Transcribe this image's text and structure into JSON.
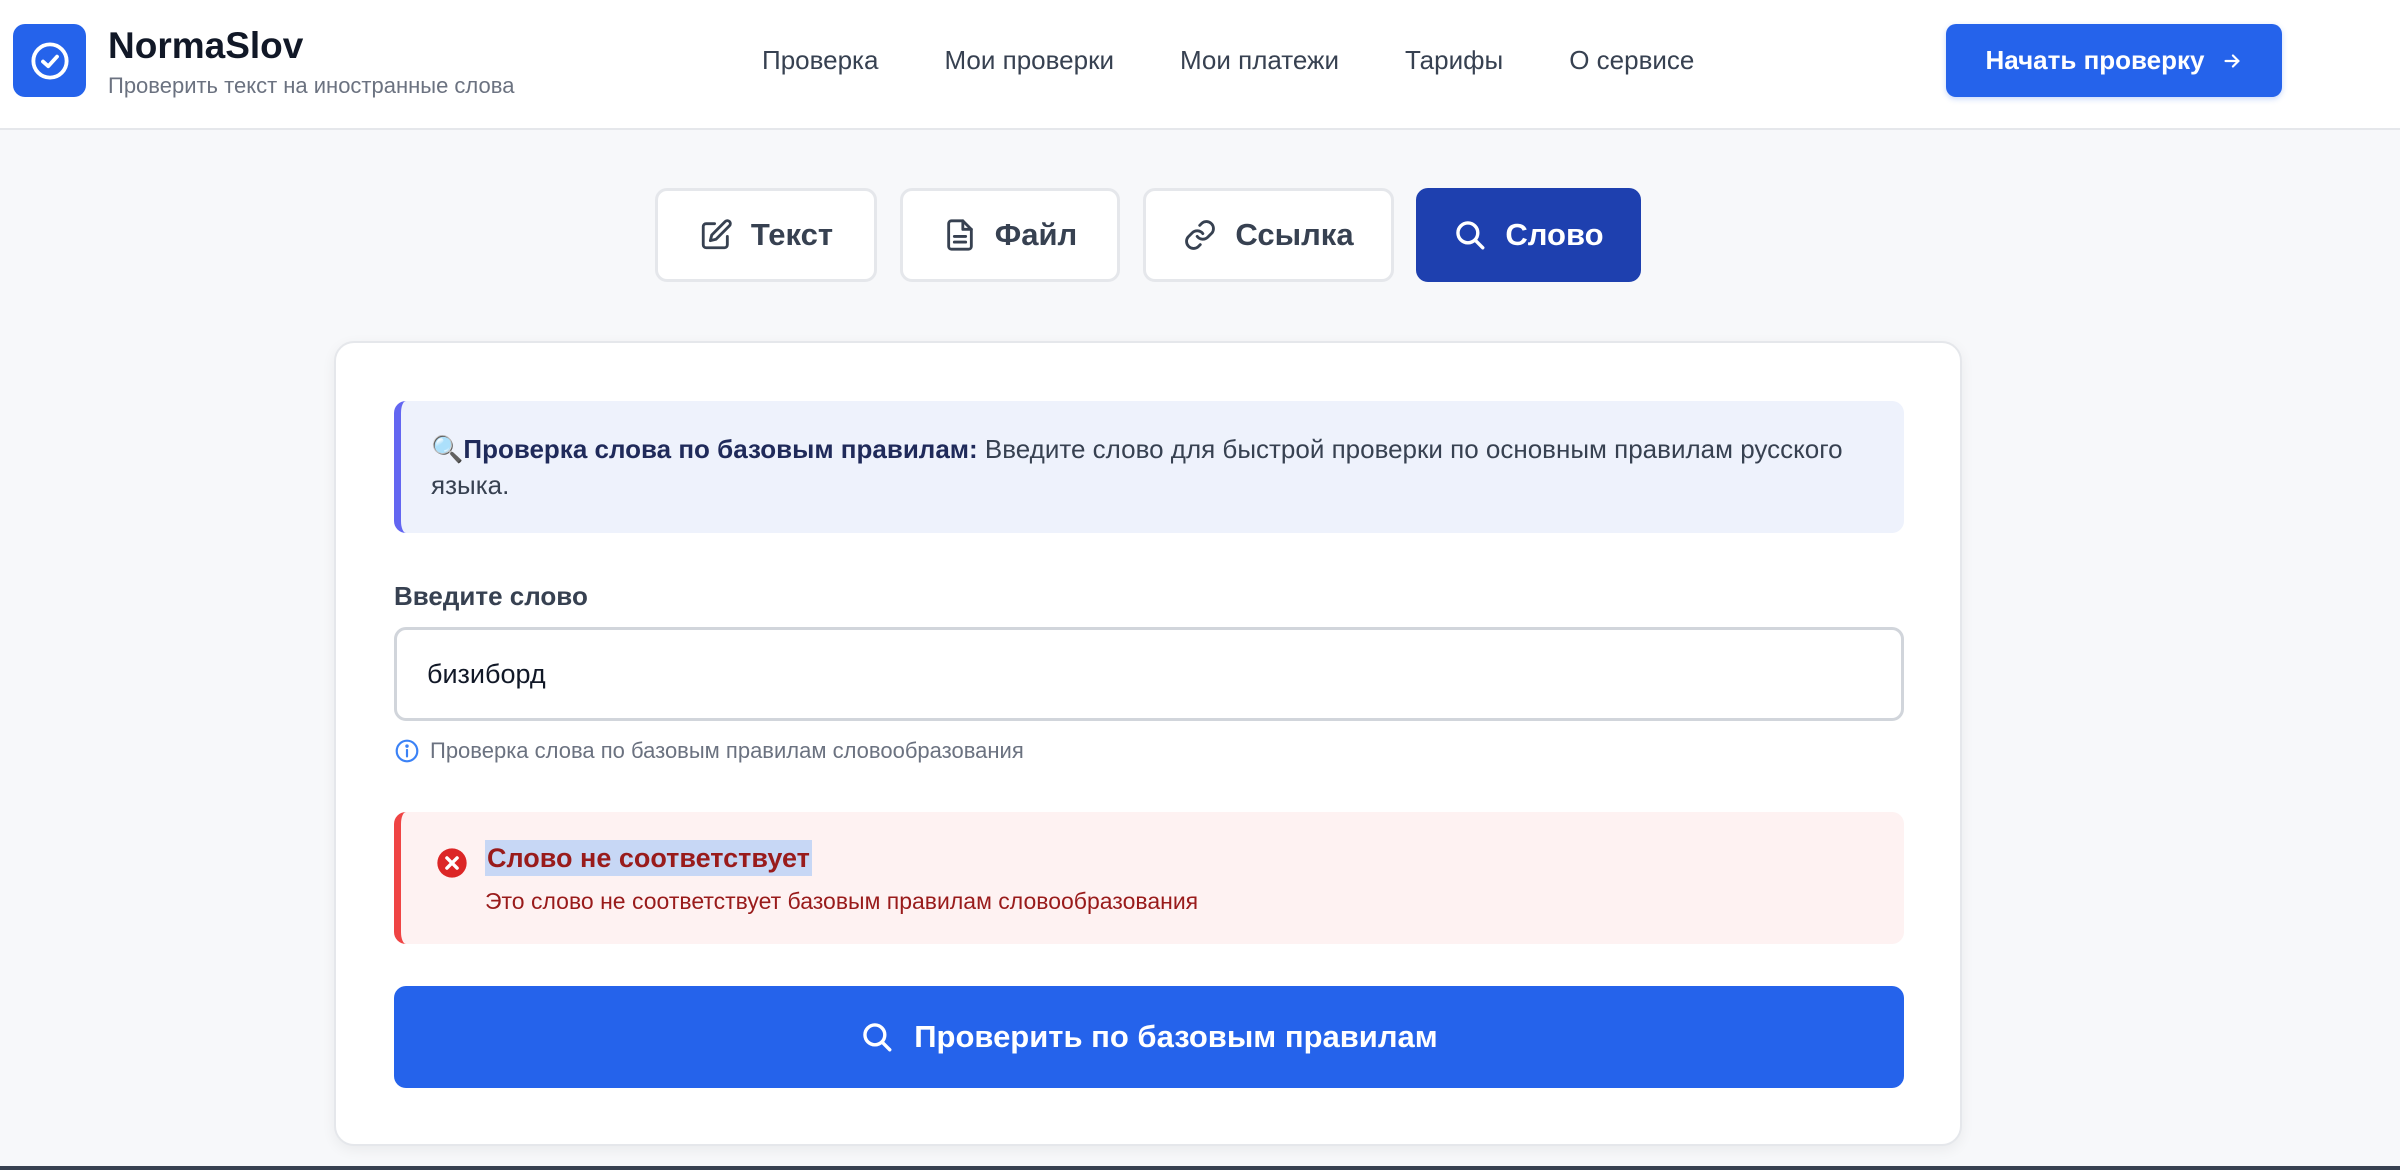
{
  "brand": {
    "name": "NormaSlov",
    "tagline": "Проверить текст на иностранные слова"
  },
  "nav": {
    "items": [
      {
        "label": "Проверка"
      },
      {
        "label": "Мои проверки"
      },
      {
        "label": "Мои платежи"
      },
      {
        "label": "Тарифы"
      },
      {
        "label": "О сервисе"
      }
    ],
    "cta_label": "Начать проверку"
  },
  "tabs": [
    {
      "label": "Текст",
      "icon": "edit-icon"
    },
    {
      "label": "Файл",
      "icon": "file-icon"
    },
    {
      "label": "Ссылка",
      "icon": "link-icon"
    },
    {
      "label": "Слово",
      "icon": "search-icon",
      "active": true
    }
  ],
  "info": {
    "emoji": "🔍",
    "bold": "Проверка слова по базовым правилам:",
    "text": " Введите слово для быстрой проверки по основным правилам русского языка."
  },
  "word_field": {
    "label": "Введите слово",
    "value": "бизиборд",
    "hint": "Проверка слова по базовым правилам словообразования"
  },
  "result": {
    "title": "Слово не соответствует",
    "text": "Это слово не соответствует базовым правилам словообразования"
  },
  "submit_label": "Проверить по базовым правилам",
  "colors": {
    "primary": "#2563eb",
    "active_tab": "#1e40af",
    "error": "#ef4444",
    "info_accent": "#6366f1"
  }
}
